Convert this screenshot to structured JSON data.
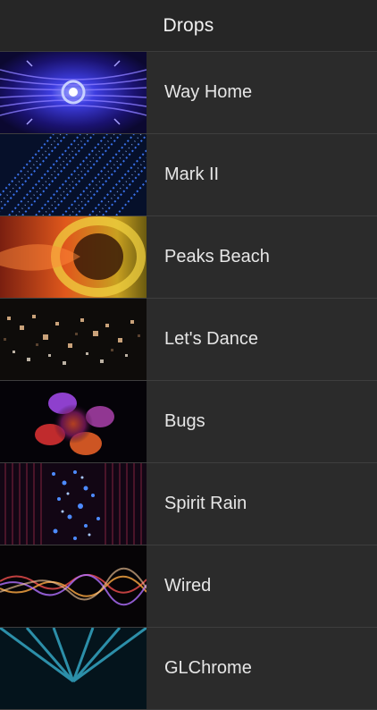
{
  "navbar": {
    "title": "Drops"
  },
  "items": [
    {
      "label": "Way Home",
      "thumb": "radial-tunnel-blue"
    },
    {
      "label": "Mark II",
      "thumb": "diagonal-dots-blue"
    },
    {
      "label": "Peaks Beach",
      "thumb": "rings-orange"
    },
    {
      "label": "Let's Dance",
      "thumb": "bokeh-grid-warm"
    },
    {
      "label": "Bugs",
      "thumb": "flower-purple-orange"
    },
    {
      "label": "Spirit Rain",
      "thumb": "rain-particles-blue-red"
    },
    {
      "label": "Wired",
      "thumb": "light-waves-warm"
    },
    {
      "label": "GLChrome",
      "thumb": "rays-cyan"
    }
  ]
}
